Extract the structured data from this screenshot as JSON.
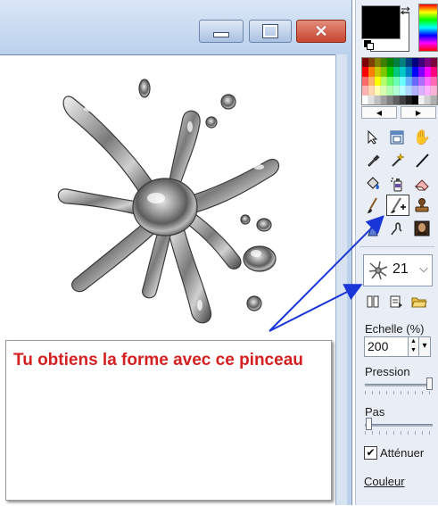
{
  "window": {
    "minimize_glyph": "—",
    "maximize_glyph": "☐",
    "close_glyph": "✕"
  },
  "palette": {
    "primary_color": "#000000",
    "secondary_color": "#ffffff",
    "swatches": [
      [
        "#7f0000",
        "#7f3f00",
        "#7f7f00",
        "#3f7f00",
        "#007f00",
        "#007f3f",
        "#007f7f",
        "#003f7f",
        "#00007f",
        "#3f007f",
        "#7f007f",
        "#7f003f"
      ],
      [
        "#ff0000",
        "#ff7f00",
        "#c8c800",
        "#7fc800",
        "#00c800",
        "#00c87f",
        "#00c8c8",
        "#007fc8",
        "#0000ff",
        "#7f00ff",
        "#ff00ff",
        "#ff007f"
      ],
      [
        "#ff6a6a",
        "#ffb26a",
        "#ffff00",
        "#b2ff6a",
        "#6aff6a",
        "#6affb2",
        "#6affff",
        "#6ab2ff",
        "#6a6aff",
        "#b26aff",
        "#ff6aff",
        "#ff6ab2"
      ],
      [
        "#ffb2b2",
        "#ffd8b2",
        "#ffffb2",
        "#d8ffb2",
        "#b2ffb2",
        "#b2ffd8",
        "#b2ffff",
        "#b2d8ff",
        "#b2b2ff",
        "#d8b2ff",
        "#ffb2ff",
        "#ffb2d8"
      ],
      [
        "#ffffff",
        "#e0e0e0",
        "#c0c0c0",
        "#a0a0a0",
        "#808080",
        "#606060",
        "#404040",
        "#202020",
        "#000000",
        "#f0f0f0",
        "#d0d0d0",
        "#b0b0b0"
      ]
    ],
    "scroll_left": "◀",
    "scroll_right": "▶"
  },
  "tools": [
    {
      "name": "select-tool",
      "glyph": "↖"
    },
    {
      "name": "layer-tool",
      "glyph": "▦"
    },
    {
      "name": "hand-tool",
      "glyph": "✋"
    },
    {
      "name": "eyedropper-tool",
      "glyph": "✎"
    },
    {
      "name": "magic-wand-tool",
      "glyph": "✧"
    },
    {
      "name": "line-tool",
      "glyph": "╱"
    },
    {
      "name": "fill-tool",
      "glyph": "◈"
    },
    {
      "name": "spray-tool",
      "glyph": "▯"
    },
    {
      "name": "eraser-tool",
      "glyph": "▭"
    },
    {
      "name": "brush-tool",
      "glyph": "╱"
    },
    {
      "name": "picture-tube-tool",
      "glyph": "✚"
    },
    {
      "name": "stamp-tool",
      "glyph": "♟"
    },
    {
      "name": "sharpen-tool",
      "glyph": "◆"
    },
    {
      "name": "smudge-tool",
      "glyph": "ϟ"
    },
    {
      "name": "portrait-tool",
      "glyph": "▣"
    }
  ],
  "brush": {
    "size_value": "21",
    "dropdown_glyph": "⌵"
  },
  "scale": {
    "label": "Echelle (%)",
    "value": "200",
    "up_glyph": "▲",
    "down_glyph": "▼",
    "dropdown_glyph": "▾"
  },
  "pressure": {
    "label": "Pression",
    "level": 0.98
  },
  "step": {
    "label": "Pas",
    "level": 0.02
  },
  "attenuate": {
    "label": "Atténuer",
    "checked": true,
    "check_glyph": "✔"
  },
  "color_link": {
    "label": "Couleur"
  },
  "annotation": {
    "text": "Tu obtiens la forme avec ce pinceau",
    "color": "#d42020"
  },
  "colors": {
    "arrow": "#1a35d8",
    "window_frame": "#bcd1ec",
    "close_button": "#c8452f"
  }
}
